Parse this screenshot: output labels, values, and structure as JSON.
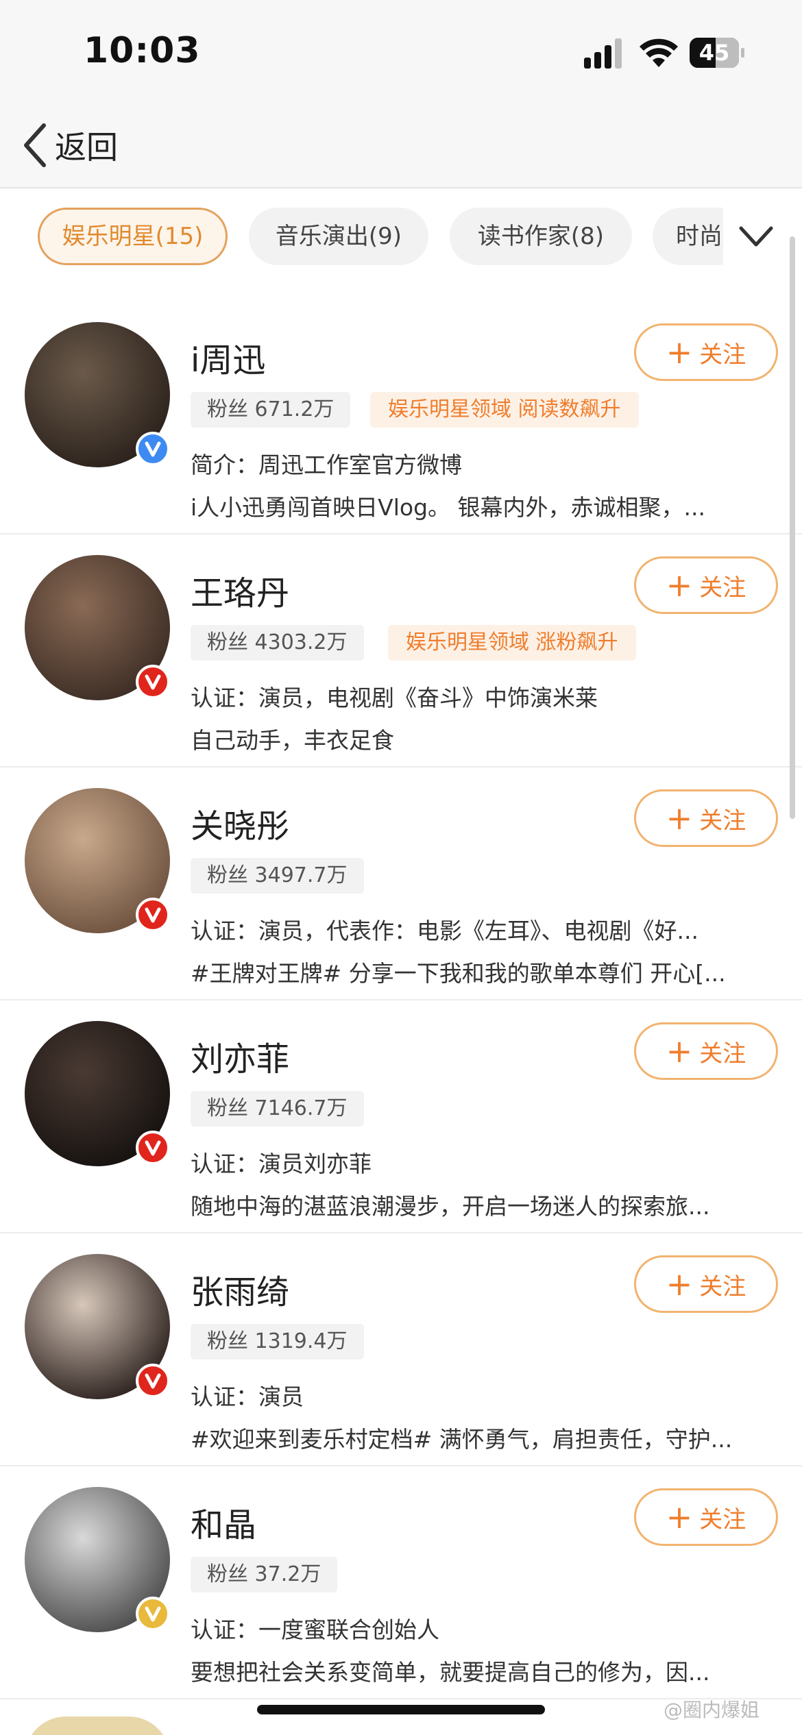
{
  "status_bar": {
    "time": "10:03",
    "battery": "45"
  },
  "nav": {
    "back_label": "返回"
  },
  "tabs": [
    {
      "label": "娱乐明星(15)",
      "active": true
    },
    {
      "label": "音乐演出(9)",
      "active": false
    },
    {
      "label": "读书作家(8)",
      "active": false
    },
    {
      "label": "时尚",
      "active": false
    }
  ],
  "follow_label": "关注",
  "users": [
    {
      "name": "i周迅",
      "fans": "粉丝 671.2万",
      "tag": "娱乐明星领域 阅读数飙升",
      "desc1": "简介：周迅工作室官方微博",
      "desc2": "i人小迅勇闯首映日Vlog。 银幕内外，赤诚相聚，...",
      "badge": "blue",
      "avatar_colors": [
        "#6b5a4a",
        "#2a211b"
      ]
    },
    {
      "name": "王珞丹",
      "fans": "粉丝 4303.2万",
      "tag": "娱乐明星领域 涨粉飙升",
      "desc1": "认证：演员，电视剧《奋斗》中饰演米莱",
      "desc2": "自己动手，丰衣足食",
      "badge": "red",
      "avatar_colors": [
        "#8a6a55",
        "#3b2c24"
      ]
    },
    {
      "name": "关晓彤",
      "fans": "粉丝 3497.7万",
      "tag": "",
      "desc1": "认证：演员，代表作：电影《左耳》、电视剧《好...",
      "desc2": "#王牌对王牌# 分享一下我和我的歌单本尊们 开心[...",
      "badge": "red",
      "avatar_colors": [
        "#c9a98c",
        "#6d513e"
      ]
    },
    {
      "name": "刘亦菲",
      "fans": "粉丝 7146.7万",
      "tag": "",
      "desc1": "认证：演员刘亦菲",
      "desc2": "随地中海的湛蓝浪潮漫步，开启一场迷人的探索旅...",
      "badge": "red",
      "avatar_colors": [
        "#4a3a33",
        "#15110f"
      ]
    },
    {
      "name": "张雨绮",
      "fans": "粉丝 1319.4万",
      "tag": "",
      "desc1": "认证：演员",
      "desc2": "#欢迎来到麦乐村定档# 满怀勇气，肩担责任，守护...",
      "badge": "red",
      "avatar_colors": [
        "#d7c7ba",
        "#2a1f1c"
      ]
    },
    {
      "name": "和晶",
      "fans": "粉丝 37.2万",
      "tag": "",
      "desc1": "认证：一度蜜联合创始人",
      "desc2": "要想把社会关系变简单，就要提高自己的修为，因...",
      "badge": "gold",
      "avatar_colors": [
        "#d9d9d9",
        "#4a4a4a"
      ]
    }
  ],
  "watermark": "@圈内爆姐",
  "colors": {
    "accent": "#ef7d2c",
    "accent_border": "#f2b36f",
    "verify_red": "#e0251c",
    "verify_blue": "#3d8bf2",
    "verify_gold": "#e8b93a"
  }
}
